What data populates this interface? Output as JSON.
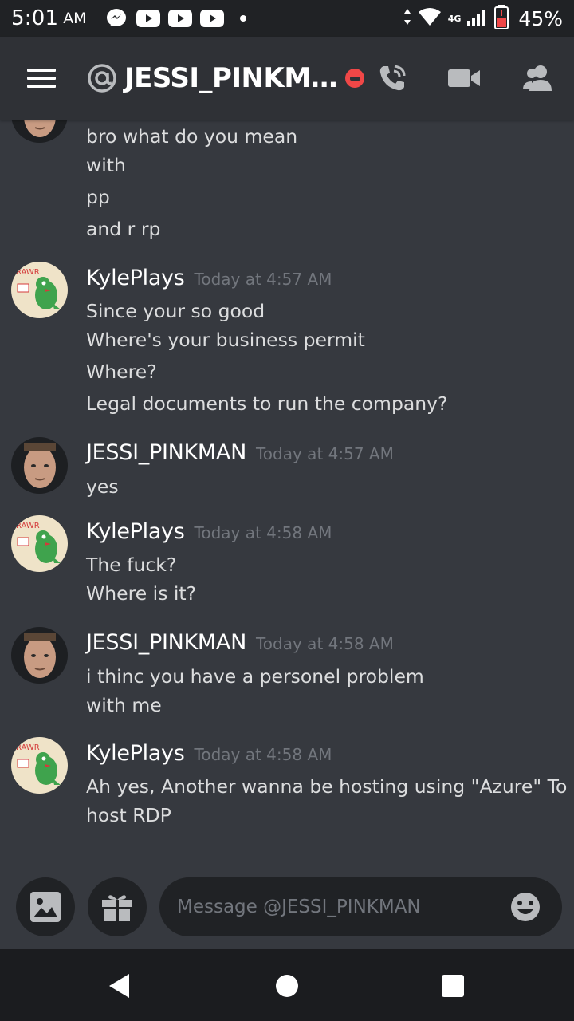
{
  "status_bar": {
    "time": "5:01",
    "ampm": "AM",
    "network": "4G",
    "battery": "45%"
  },
  "header": {
    "title": "JESSI_PINKM…"
  },
  "messages": {
    "continuation_lines": [
      "bro what do you mean",
      "with",
      "pp",
      "and r rp"
    ],
    "groups": [
      {
        "author": "KylePlays",
        "timestamp": "Today at 4:57 AM",
        "lines": [
          "Since your so good",
          "Where's your business permit",
          "Where?",
          "Legal documents to run the company?"
        ]
      },
      {
        "author": "JESSI_PINKMAN",
        "timestamp": "Today at 4:57 AM",
        "lines": [
          "yes"
        ]
      },
      {
        "author": "KylePlays",
        "timestamp": "Today at 4:58 AM",
        "lines": [
          "The fuck?",
          "Where is it?"
        ]
      },
      {
        "author": "JESSI_PINKMAN",
        "timestamp": "Today at 4:58 AM",
        "lines": [
          "i thinc you have a personel problem",
          "with me"
        ]
      },
      {
        "author": "KylePlays",
        "timestamp": "Today at 4:58 AM",
        "lines": [
          "Ah yes, Another wanna be hosting using \"Azure\" To",
          "host RDP"
        ]
      }
    ]
  },
  "input": {
    "placeholder": "Message @JESSI_PINKMAN",
    "value": ""
  },
  "avatar_text": {
    "kyle": "RAWR"
  },
  "icons": {
    "menu": "hamburger-icon",
    "at": "at-sign-icon",
    "call": "phone-call-icon",
    "video": "video-camera-icon",
    "members": "members-icon",
    "image": "image-icon",
    "gift": "gift-icon",
    "emoji": "emoji-icon"
  },
  "colors": {
    "background": "#36393f",
    "header": "#2f3136",
    "input": "#202225",
    "dnd": "#f04747",
    "timestamp": "#72767d"
  }
}
